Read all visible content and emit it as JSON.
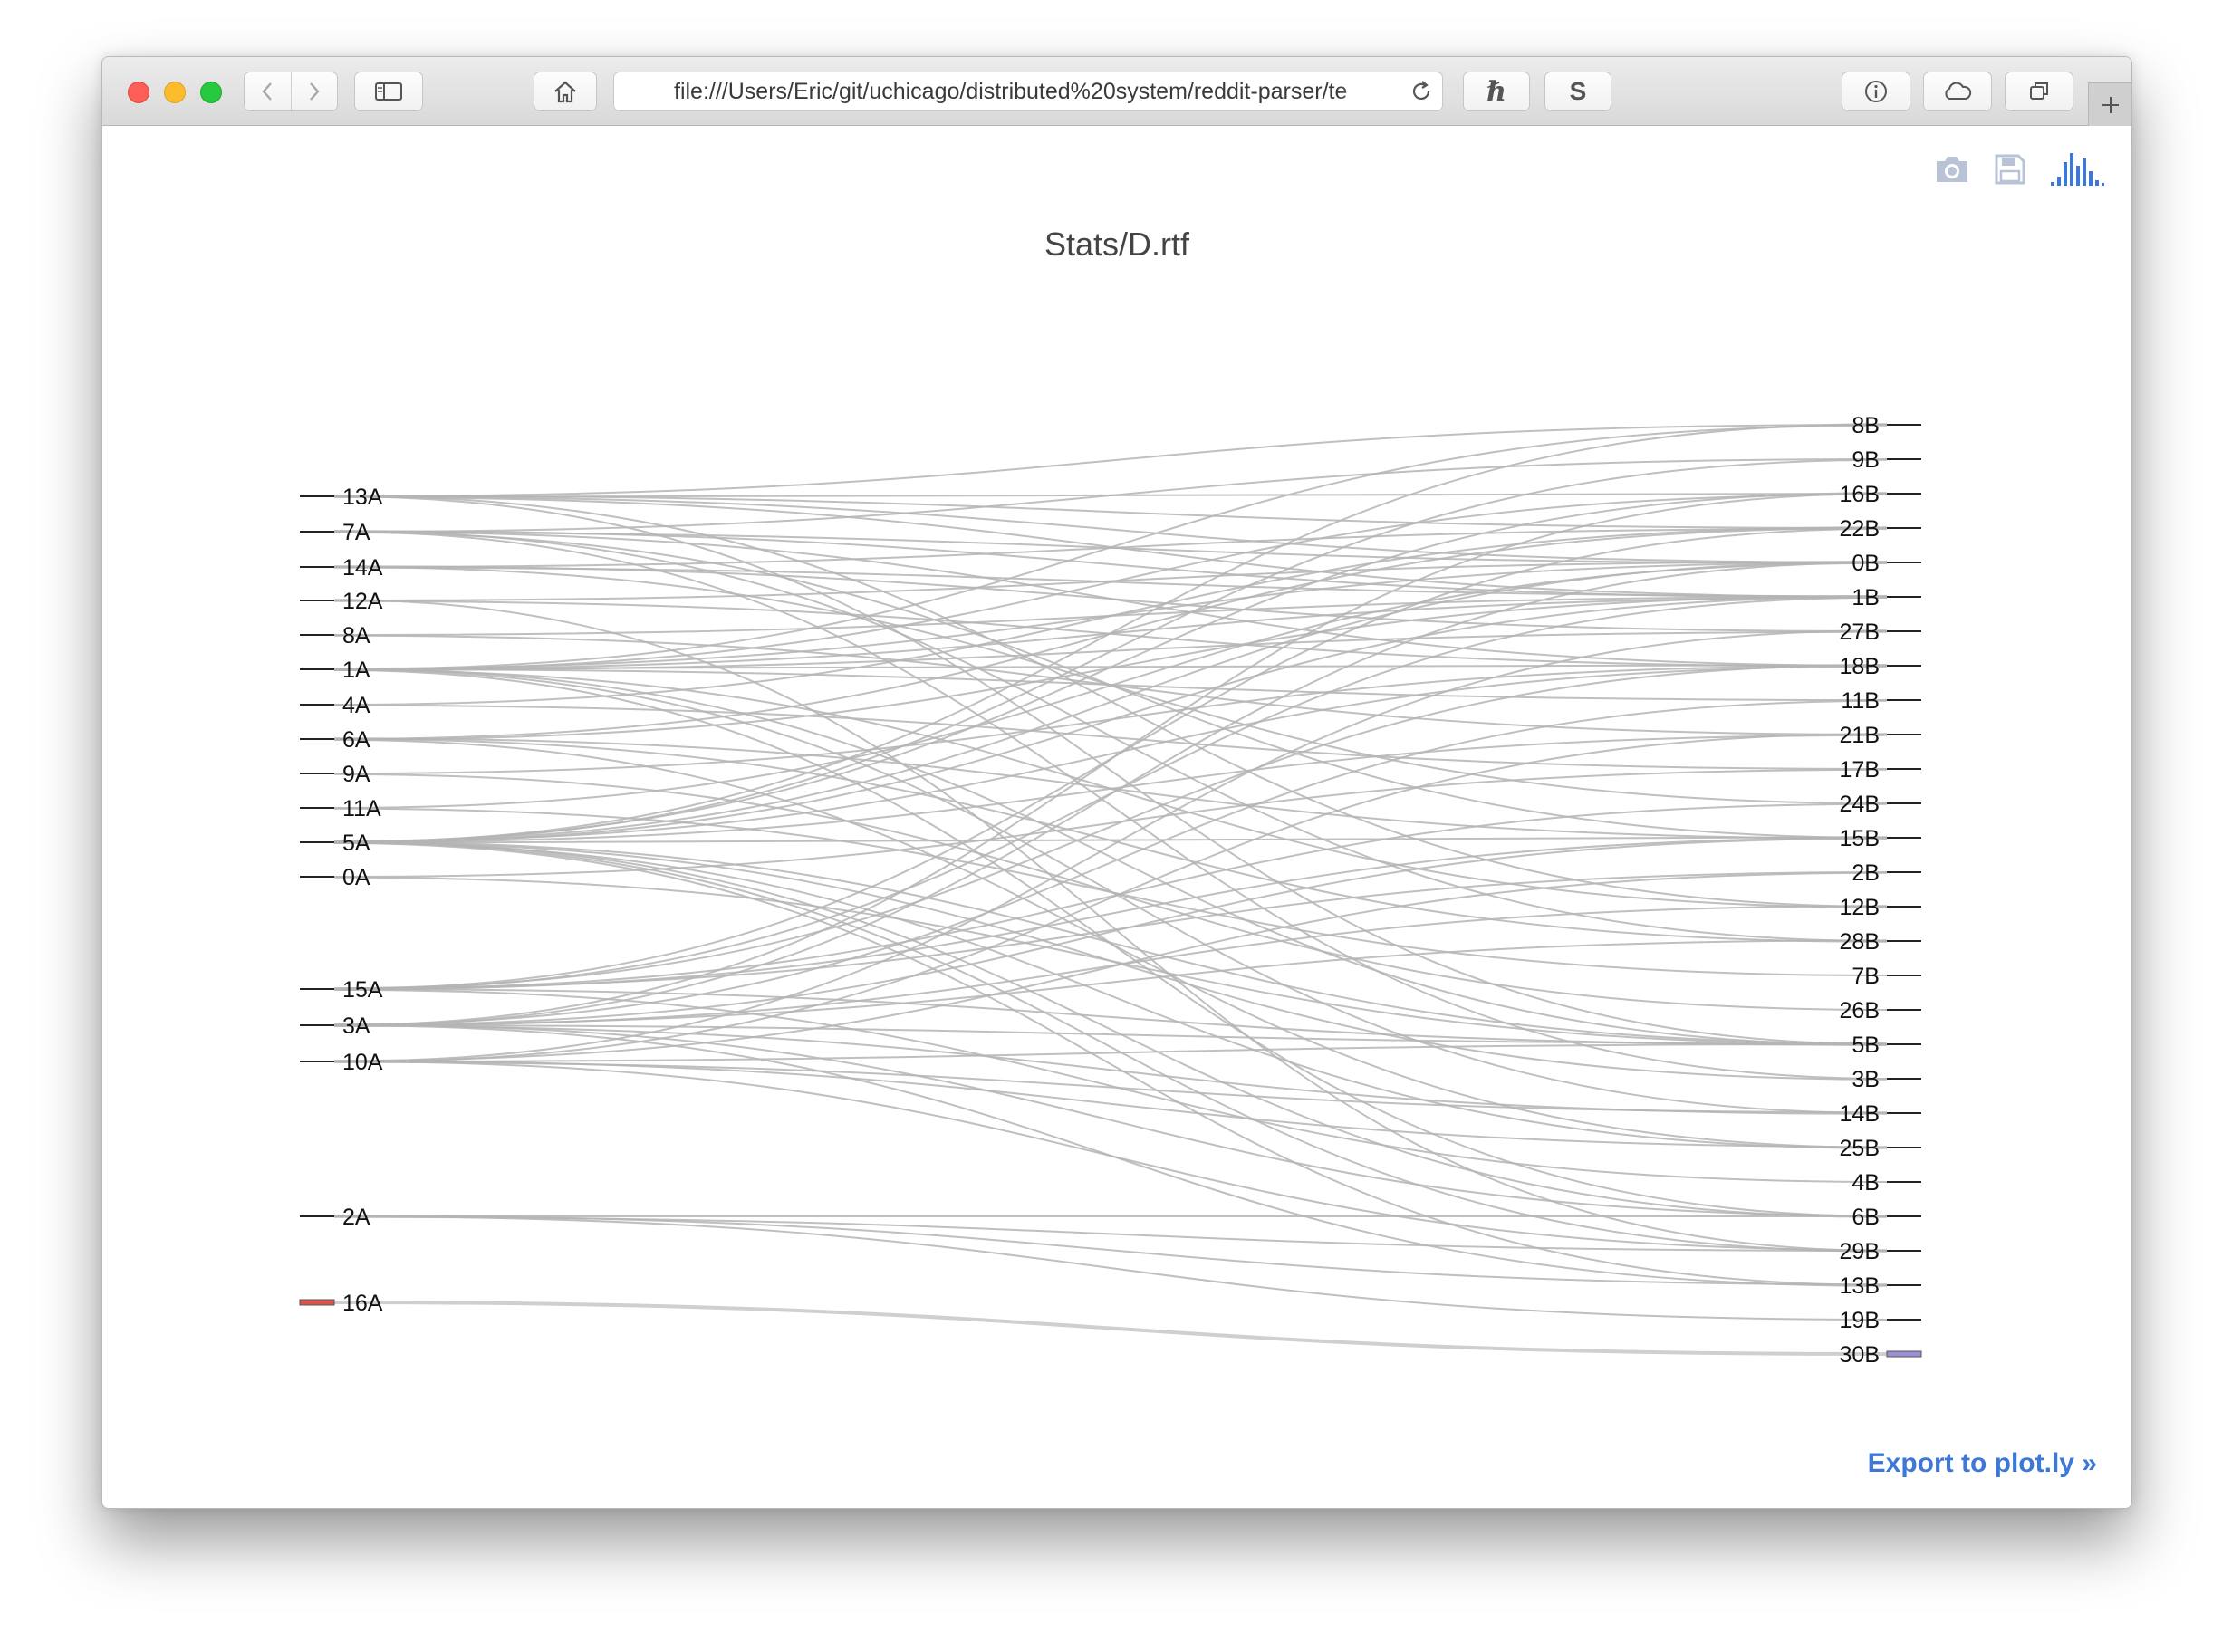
{
  "browser": {
    "url": "file:///Users/Eric/git/uchicago/distributed%20system/reddit-parser/te",
    "extension_1_label": "ℏ",
    "extension_2_label": "S",
    "traffic_light_colors": {
      "close": "#fc5f57",
      "minimize": "#fdbc2e",
      "zoom": "#28c840"
    }
  },
  "plot": {
    "title": "Stats/D.rtf",
    "export_label": "Export to plot.ly »",
    "modebar": [
      "camera-icon",
      "save-icon",
      "plotly-logo-icon"
    ]
  },
  "chart_data": {
    "type": "sankey",
    "title": "Stats/D.rtf",
    "source_nodes": [
      "13A",
      "7A",
      "14A",
      "12A",
      "8A",
      "1A",
      "4A",
      "6A",
      "9A",
      "11A",
      "5A",
      "0A",
      "15A",
      "3A",
      "10A",
      "2A",
      "16A"
    ],
    "target_nodes": [
      "8B",
      "9B",
      "16B",
      "22B",
      "0B",
      "1B",
      "27B",
      "18B",
      "11B",
      "21B",
      "17B",
      "24B",
      "15B",
      "2B",
      "12B",
      "28B",
      "7B",
      "26B",
      "5B",
      "3B",
      "14B",
      "25B",
      "4B",
      "6B",
      "29B",
      "13B",
      "19B",
      "30B"
    ],
    "node_colors": {
      "16A": "#d9534f",
      "30B": "#9b8fd6"
    },
    "link_color": "#b4b4b4",
    "links": [
      [
        "13A",
        "8B"
      ],
      [
        "13A",
        "16B"
      ],
      [
        "13A",
        "22B"
      ],
      [
        "13A",
        "0B"
      ],
      [
        "13A",
        "1B"
      ],
      [
        "13A",
        "12B"
      ],
      [
        "13A",
        "5B"
      ],
      [
        "7A",
        "9B"
      ],
      [
        "7A",
        "0B"
      ],
      [
        "7A",
        "1B"
      ],
      [
        "7A",
        "18B"
      ],
      [
        "7A",
        "15B"
      ],
      [
        "7A",
        "28B"
      ],
      [
        "7A",
        "3B"
      ],
      [
        "14A",
        "22B"
      ],
      [
        "14A",
        "1B"
      ],
      [
        "14A",
        "27B"
      ],
      [
        "14A",
        "24B"
      ],
      [
        "12A",
        "0B"
      ],
      [
        "12A",
        "18B"
      ],
      [
        "12A",
        "29B"
      ],
      [
        "8A",
        "1B"
      ],
      [
        "8A",
        "21B"
      ],
      [
        "1A",
        "8B"
      ],
      [
        "1A",
        "16B"
      ],
      [
        "1A",
        "0B"
      ],
      [
        "1A",
        "1B"
      ],
      [
        "1A",
        "27B"
      ],
      [
        "1A",
        "18B"
      ],
      [
        "1A",
        "11B"
      ],
      [
        "1A",
        "12B"
      ],
      [
        "1A",
        "5B"
      ],
      [
        "1A",
        "14B"
      ],
      [
        "1A",
        "6B"
      ],
      [
        "4A",
        "22B"
      ],
      [
        "4A",
        "17B"
      ],
      [
        "6A",
        "22B"
      ],
      [
        "6A",
        "1B"
      ],
      [
        "6A",
        "15B"
      ],
      [
        "6A",
        "28B"
      ],
      [
        "6A",
        "25B"
      ],
      [
        "9A",
        "18B"
      ],
      [
        "9A",
        "26B"
      ],
      [
        "11A",
        "0B"
      ],
      [
        "11A",
        "7B"
      ],
      [
        "5A",
        "8B"
      ],
      [
        "5A",
        "9B"
      ],
      [
        "5A",
        "16B"
      ],
      [
        "5A",
        "0B"
      ],
      [
        "5A",
        "1B"
      ],
      [
        "5A",
        "18B"
      ],
      [
        "5A",
        "21B"
      ],
      [
        "5A",
        "15B"
      ],
      [
        "5A",
        "5B"
      ],
      [
        "5A",
        "3B"
      ],
      [
        "5A",
        "25B"
      ],
      [
        "5A",
        "6B"
      ],
      [
        "5A",
        "29B"
      ],
      [
        "5A",
        "13B"
      ],
      [
        "0A",
        "17B"
      ],
      [
        "0A",
        "5B"
      ],
      [
        "15A",
        "22B"
      ],
      [
        "15A",
        "1B"
      ],
      [
        "15A",
        "18B"
      ],
      [
        "15A",
        "24B"
      ],
      [
        "15A",
        "15B"
      ],
      [
        "15A",
        "2B"
      ],
      [
        "15A",
        "5B"
      ],
      [
        "15A",
        "4B"
      ],
      [
        "3A",
        "16B"
      ],
      [
        "3A",
        "0B"
      ],
      [
        "3A",
        "11B"
      ],
      [
        "3A",
        "15B"
      ],
      [
        "3A",
        "12B"
      ],
      [
        "3A",
        "28B"
      ],
      [
        "3A",
        "5B"
      ],
      [
        "3A",
        "14B"
      ],
      [
        "3A",
        "6B"
      ],
      [
        "3A",
        "13B"
      ],
      [
        "10A",
        "27B"
      ],
      [
        "10A",
        "21B"
      ],
      [
        "10A",
        "2B"
      ],
      [
        "10A",
        "5B"
      ],
      [
        "10A",
        "14B"
      ],
      [
        "10A",
        "25B"
      ],
      [
        "10A",
        "29B"
      ],
      [
        "2A",
        "6B"
      ],
      [
        "2A",
        "29B"
      ],
      [
        "2A",
        "13B"
      ],
      [
        "2A",
        "19B"
      ],
      [
        "16A",
        "30B"
      ]
    ]
  }
}
